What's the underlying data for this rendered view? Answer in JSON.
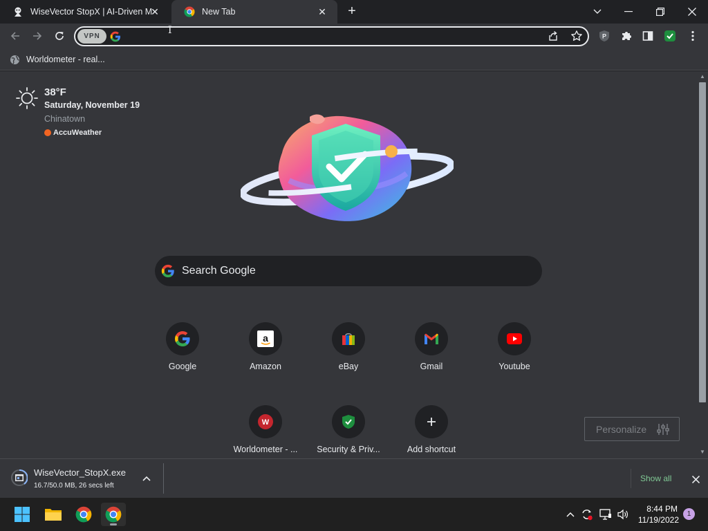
{
  "browser": {
    "tabs": [
      {
        "title": "WiseVector StopX | AI-Driven Ma",
        "favicon": "wisevector-icon"
      },
      {
        "title": "New Tab",
        "favicon": "chrome-icon"
      }
    ],
    "omnibox": {
      "vpn_label": "VPN",
      "value": "",
      "placeholder": ""
    },
    "bookmarks": [
      {
        "label": "Worldometer - real...",
        "icon": "globe-icon"
      }
    ]
  },
  "newtab": {
    "weather": {
      "temp": "38°F",
      "date": "Saturday, November 19",
      "location": "Chinatown",
      "source": "AccuWeather"
    },
    "search_placeholder": "Search Google",
    "shortcuts": [
      {
        "label": "Google",
        "icon": "google-icon"
      },
      {
        "label": "Amazon",
        "icon": "amazon-icon"
      },
      {
        "label": "eBay",
        "icon": "ebay-icon"
      },
      {
        "label": "Gmail",
        "icon": "gmail-icon"
      },
      {
        "label": "Youtube",
        "icon": "youtube-icon"
      },
      {
        "label": "Worldometer - ...",
        "icon": "worldometer-icon"
      },
      {
        "label": "Security & Priv...",
        "icon": "shield-check-icon"
      },
      {
        "label": "Add shortcut",
        "icon": "plus-icon"
      }
    ],
    "personalize_label": "Personalize"
  },
  "download": {
    "filename": "WiseVector_StopX.exe",
    "status": "16.7/50.0 MB, 26 secs left",
    "show_all": "Show all"
  },
  "taskbar": {
    "time": "8:44 PM",
    "date": "11/19/2022",
    "notifications": "1"
  },
  "colors": {
    "chrome_dark": "#202124",
    "chrome_surface": "#35363a",
    "accent_green": "#81c995"
  }
}
